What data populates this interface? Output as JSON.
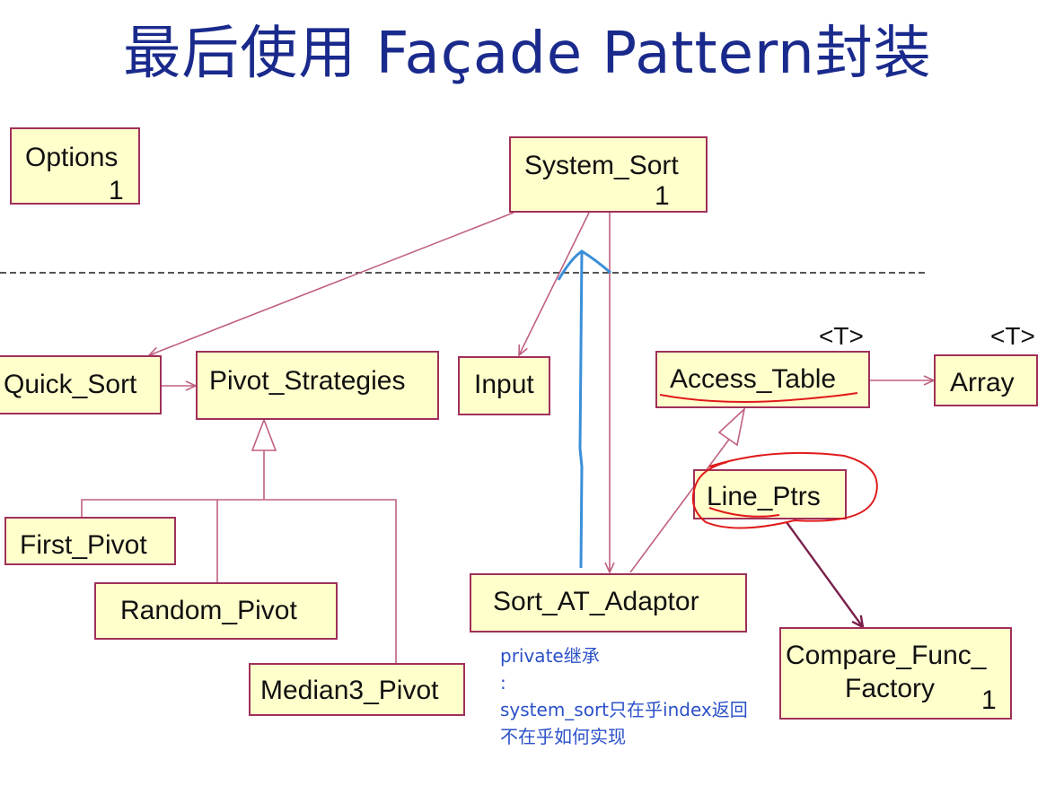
{
  "title": "最后使用 Façade Pattern封装",
  "classes": {
    "options": {
      "name": "Options",
      "multiplicity": "1"
    },
    "system_sort": {
      "name": "System_Sort",
      "multiplicity": "1"
    },
    "quick_sort": {
      "name": "Quick_Sort"
    },
    "pivot_strategies": {
      "name": "Pivot_Strategies"
    },
    "input": {
      "name": "Input"
    },
    "access_table": {
      "name": "Access_Table",
      "template": "<T>"
    },
    "array": {
      "name": "Array",
      "template": "<T>"
    },
    "line_ptrs": {
      "name": "Line_Ptrs"
    },
    "first_pivot": {
      "name": "First_Pivot"
    },
    "random_pivot": {
      "name": "Random_Pivot"
    },
    "median3_pivot": {
      "name": "Median3_Pivot"
    },
    "sort_at_adaptor": {
      "name": "Sort_AT_Adaptor"
    },
    "compare_func_factory": {
      "name_line1": "Compare_Func_",
      "name_line2": "Factory",
      "multiplicity": "1"
    }
  },
  "note": {
    "line1": "private继承",
    "line2": ":",
    "line3": "system_sort只在乎index返回",
    "line4": "不在乎如何实现"
  },
  "colors": {
    "title": "#1a2a8c",
    "class_fill": "#ffffcc",
    "class_border": "#a0305a",
    "relation_line": "#c06080",
    "blue_annotation": "#3a8fd8",
    "red_annotation": "#e01a1a",
    "note_text": "#2b50c8"
  }
}
